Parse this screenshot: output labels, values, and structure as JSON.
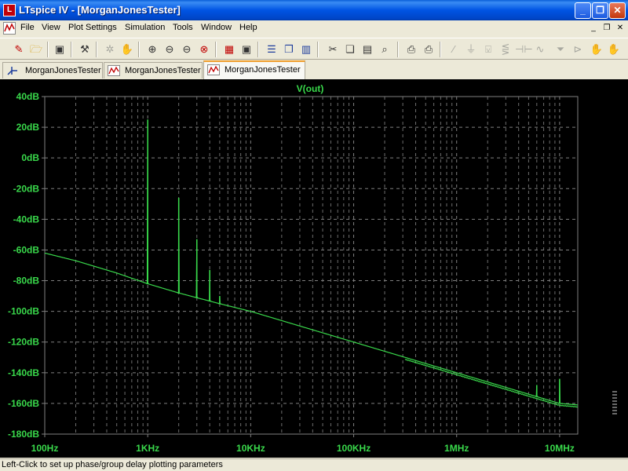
{
  "window": {
    "title": "LTspice IV - [MorganJonesTester]",
    "logo_text": "L",
    "minimize_glyph": "_",
    "maximize_glyph": "❐",
    "close_glyph": "✕"
  },
  "menu": {
    "items": [
      "File",
      "View",
      "Plot Settings",
      "Simulation",
      "Tools",
      "Window",
      "Help"
    ],
    "mdi_minimize": "_",
    "mdi_restore": "❐",
    "mdi_close": "✕"
  },
  "toolbar": {
    "icons": [
      "new-schematic-icon",
      "open-icon",
      "save-icon",
      "control-panel-icon",
      "autorange-icon",
      "pan-icon",
      "zoom-in-icon",
      "zoom-out-icon",
      "zoom-fit-icon",
      "zoom-cancel-icon",
      "grid-icon",
      "marching-waves-icon",
      "tile-horizontal-icon",
      "cascade-icon",
      "tile-vertical-icon",
      "cut-icon",
      "copy-icon",
      "paste-icon",
      "find-icon",
      "print-setup-icon",
      "print-icon",
      "wire-icon",
      "ground-icon",
      "label-icon",
      "resistor-icon",
      "capacitor-icon",
      "inductor-icon",
      "diode-icon",
      "component-icon",
      "move-icon"
    ]
  },
  "tabs": [
    {
      "label": "MorganJonesTester",
      "kind": "schematic"
    },
    {
      "label": "MorganJonesTester",
      "kind": "waveform"
    },
    {
      "label": "MorganJonesTester",
      "kind": "waveform",
      "active": true
    }
  ],
  "plot": {
    "trace_name": "V(out)",
    "background": "#000000",
    "trace_color": "#39d94b",
    "grid_color": "#808080",
    "axis_text_color": "#39d94b"
  },
  "chart_data": {
    "type": "line",
    "title": "V(out)",
    "xlabel": "",
    "ylabel": "",
    "xscale": "log",
    "xlim": [
      100,
      15000000
    ],
    "ylim": [
      -180,
      40
    ],
    "x_ticks": [
      "100Hz",
      "1KHz",
      "10KHz",
      "100KHz",
      "1MHz",
      "10MHz"
    ],
    "y_ticks": [
      "40dB",
      "20dB",
      "0dB",
      "-20dB",
      "-40dB",
      "-60dB",
      "-80dB",
      "-100dB",
      "-120dB",
      "-140dB",
      "-160dB",
      "-180dB"
    ],
    "grid": true,
    "series": [
      {
        "name": "V(out)",
        "baseline": [
          [
            100,
            -62
          ],
          [
            200,
            -67
          ],
          [
            500,
            -75
          ],
          [
            1000,
            -82
          ],
          [
            2000,
            -88
          ],
          [
            5000,
            -95
          ],
          [
            10000,
            -100
          ],
          [
            100000,
            -120
          ],
          [
            1000000,
            -140
          ],
          [
            10000000,
            -160
          ],
          [
            15000000,
            -161
          ]
        ],
        "harmonics": [
          [
            1000,
            25
          ],
          [
            2000,
            -26
          ],
          [
            3000,
            -53
          ],
          [
            4000,
            -73
          ],
          [
            5000,
            -90
          ],
          [
            4000000,
            -152
          ],
          [
            6000000,
            -148
          ],
          [
            10000000,
            -144
          ]
        ]
      }
    ]
  },
  "status": {
    "text": "Left-Click to set up phase/group delay plotting parameters"
  }
}
